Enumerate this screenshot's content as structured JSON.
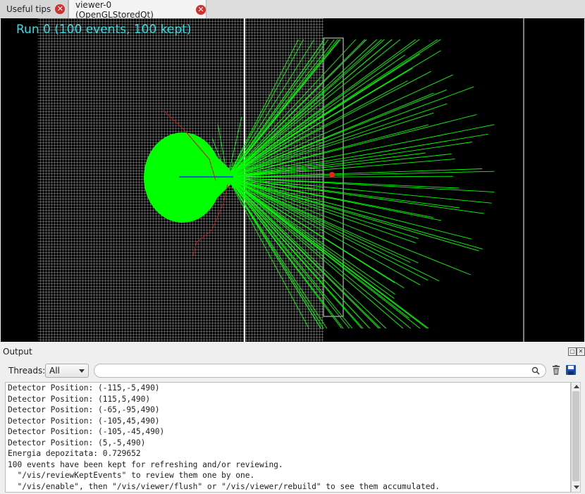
{
  "tabs": [
    {
      "label": "Useful tips",
      "close_icon": "close-icon"
    },
    {
      "label": "viewer-0 (OpenGLStoredQt)",
      "close_icon": "close-icon"
    }
  ],
  "viewer": {
    "run_label": "Run 0 (100 events, 100 kept)",
    "colors": {
      "background": "#000000",
      "grid": "#ffffff",
      "tracks": "#00ff00",
      "beam": "#0000ff",
      "secondary": "#cc1111",
      "label": "#29e3e8"
    }
  },
  "output": {
    "title": "Output",
    "threads_label": "Threads:",
    "threads_value": "All",
    "search_value": "",
    "lines": [
      "Detector Position: (-115,-5,490)",
      "Detector Position: (115,5,490)",
      "Detector Position: (-65,-95,490)",
      "Detector Position: (-105,45,490)",
      "Detector Position: (-105,-45,490)",
      "Detector Position: (5,-5,490)",
      "Energia depozitata: 0.729652",
      "100 events have been kept for refreshing and/or reviewing.",
      "  \"/vis/reviewKeptEvents\" to review them one by one.",
      "  \"/vis/enable\", then \"/vis/viewer/flush\" or \"/vis/viewer/rebuild\" to see them accumulated."
    ]
  }
}
